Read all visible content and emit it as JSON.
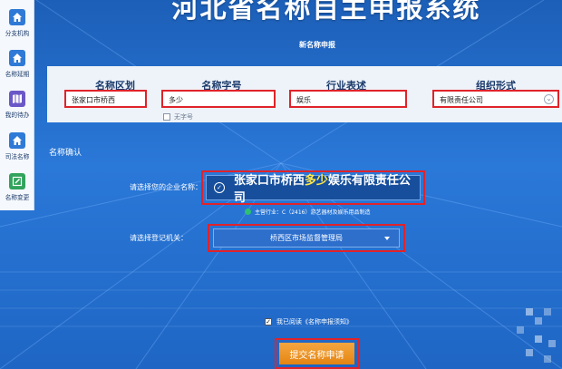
{
  "app": {
    "title": "河北省名称自主申报系统"
  },
  "sidebar": {
    "items": [
      {
        "label": "分支机构",
        "icon": "home-icon"
      },
      {
        "label": "名称延期",
        "icon": "home-icon"
      },
      {
        "label": "我的待办",
        "icon": "map-icon"
      },
      {
        "label": "司法名称",
        "icon": "home-icon"
      },
      {
        "label": "名称变更",
        "icon": "edit-icon"
      }
    ]
  },
  "form": {
    "section_title": "新名称申报",
    "fields": {
      "region": {
        "label": "名称区划",
        "value": "张家口市桥西"
      },
      "word": {
        "label": "名称字号",
        "value": "多少"
      },
      "industry": {
        "label": "行业表述",
        "value": "娱乐"
      },
      "org_form": {
        "label": "组织形式",
        "value": "有限责任公司"
      }
    },
    "no_name_label": "无字号"
  },
  "confirm": {
    "title": "名称确认",
    "company_label": "请选择您的企业名称：",
    "company_name": {
      "region": "张家口市桥西",
      "word": "多少",
      "rest": "娱乐有限责任公司"
    },
    "industry_note": "主营行业：C（2416）游艺器材及娱乐用品制造",
    "authority_label": "请选择登记机关：",
    "authority_value": "桥西区市场监督管理局"
  },
  "agreement": {
    "label": "我已阅读《名称申报须知》"
  },
  "submit": {
    "label": "提交名称申请"
  },
  "colors": {
    "background": "#2a78d8",
    "highlight_border": "#e0232a",
    "submit": "#e58512",
    "name_word": "#ffe94a"
  }
}
